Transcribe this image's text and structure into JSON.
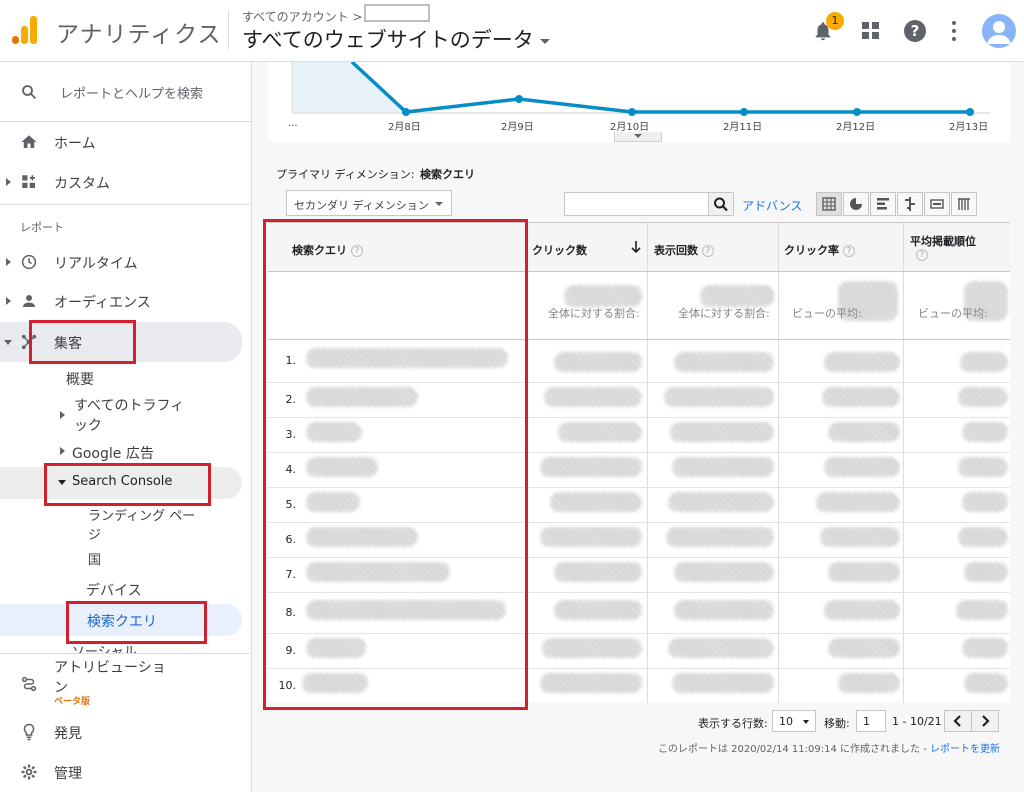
{
  "header": {
    "app_name": "アナリティクス",
    "breadcrumb": "すべてのアカウント >",
    "property": "すべてのウェブサイトのデータ",
    "notification_count": "1"
  },
  "sidebar": {
    "search_placeholder": "レポートとヘルプを検索",
    "home": "ホーム",
    "custom": "カスタム",
    "section_reports": "レポート",
    "realtime": "リアルタイム",
    "audience": "オーディエンス",
    "acquisition": "集客",
    "acq_items": {
      "overview": "概要",
      "all_traffic": "すべてのトラフィ",
      "all_traffic_2": "ック",
      "google_ads": "Google 広告",
      "search_console": "Search Console",
      "landing_pages": "ランディング ページ",
      "landing_pages_1": "ランディング ペー",
      "landing_pages_2": "ジ",
      "countries": "国",
      "devices": "デバイス",
      "queries": "検索クエリ",
      "social": "ソーシャル"
    },
    "attribution": "アトリビューショ",
    "attribution_2": "ン",
    "beta": "ベータ版",
    "discover": "発見",
    "admin": "管理"
  },
  "chart": {
    "x_ticks": [
      "...",
      "2月8日",
      "2月9日",
      "2月10日",
      "2月11日",
      "2月12日",
      "2月13日"
    ],
    "line_color": "#058dc7"
  },
  "report": {
    "primary_dimension_label": "プライマリ ディメンション:",
    "primary_dimension_value": "検索クエリ",
    "secondary_dimension": "セカンダリ ディメンション",
    "advanced": "アドバンス",
    "columns": {
      "query": "検索クエリ",
      "clicks": "クリック数",
      "impressions": "表示回数",
      "ctr": "クリック率",
      "position": "平均掲載順位"
    },
    "totals_sub": {
      "clicks": "全体に対する割合:",
      "impressions": "全体に対する割合:",
      "ctr": "ビューの平均:",
      "position": "ビューの平均:"
    },
    "row_numbers": [
      "1.",
      "2.",
      "3.",
      "4.",
      "5.",
      "6.",
      "7.",
      "8.",
      "9.",
      "10."
    ]
  },
  "pager": {
    "rows_label": "表示する行数:",
    "rows_value": "10",
    "goto_label": "移動:",
    "goto_value": "1",
    "range": "1 - 10/21"
  },
  "footer": {
    "created": "このレポートは 2020/02/14 11:09:14 に作成されました -",
    "refresh": "レポートを更新"
  },
  "colors": {
    "accent_red": "#d3202f",
    "link_blue": "#1a73e8",
    "logo_orange": "#f9ab00",
    "logo_dark_orange": "#e37400"
  }
}
